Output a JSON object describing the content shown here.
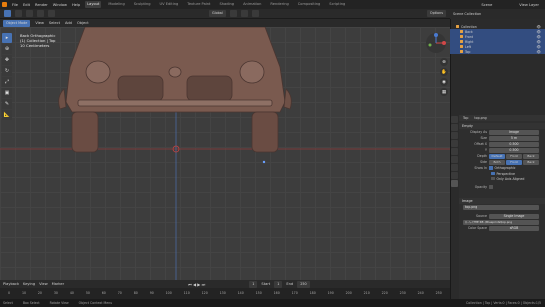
{
  "topbar": {
    "menus": [
      "File",
      "Edit",
      "Render",
      "Window",
      "Help"
    ],
    "workspaces": [
      "Layout",
      "Modeling",
      "Sculpting",
      "UV Editing",
      "Texture Paint",
      "Shading",
      "Animation",
      "Rendering",
      "Compositing",
      "Scripting"
    ],
    "active_workspace": "Layout",
    "scene": "Scene",
    "view_layer": "View Layer"
  },
  "toolbar": {
    "mode": "Object Mode",
    "menus": [
      "View",
      "Select",
      "Add",
      "Object"
    ],
    "orientation": "Global",
    "options": "Options"
  },
  "viewport": {
    "info_lines": [
      "Back Orthographic",
      "(1) Collection | Top",
      "10 Centimeters"
    ],
    "gizmo_axes": [
      "X",
      "Y",
      "Z"
    ]
  },
  "outliner": {
    "title": "Scene Collection",
    "rows": [
      {
        "label": "Collection",
        "selected": false
      },
      {
        "label": "Back",
        "selected": true
      },
      {
        "label": "Front",
        "selected": true
      },
      {
        "label": "Right",
        "selected": true
      },
      {
        "label": "Left",
        "selected": true
      },
      {
        "label": "Top",
        "selected": true
      }
    ]
  },
  "properties": {
    "object_name": "Top",
    "data_name": "top.png",
    "section_empty": "Empty",
    "display_as_label": "Display As",
    "display_as_value": "Image",
    "size_label": "Size",
    "size_value": "5 m",
    "offset_x_label": "Offset X",
    "offset_x_value": "0.500",
    "offset_y_label": "Y",
    "offset_y_value": "0.500",
    "depth_label": "Depth",
    "depth_options": [
      "Default",
      "Front",
      "Back"
    ],
    "side_label": "Side",
    "side_options": [
      "Both",
      "Front",
      "Back"
    ],
    "show_in_label": "Show In",
    "checks": [
      "Orthographic",
      "Perspective",
      "Only Axis Aligned"
    ],
    "opacity_label": "Opacity",
    "section_image": "Image",
    "image_name": "top.png",
    "source_label": "Source",
    "source_value": "Single Image",
    "filepath": "//...\\..\\THE RE..\\Blueprints\\top.png",
    "colorspace_label": "Color Space",
    "colorspace_value": "sRGB"
  },
  "timeline": {
    "menus": [
      "Playback",
      "Keying",
      "View",
      "Marker"
    ],
    "ticks": [
      "0",
      "10",
      "20",
      "30",
      "40",
      "50",
      "60",
      "70",
      "80",
      "90",
      "100",
      "110",
      "120",
      "130",
      "140",
      "150",
      "160",
      "170",
      "180",
      "190",
      "200",
      "210",
      "220",
      "230",
      "240",
      "250"
    ],
    "start_label": "Start",
    "start_value": "1",
    "end_label": "End",
    "end_value": "250",
    "current_frame": "1"
  },
  "status": {
    "items": [
      "Select",
      "Box Select",
      "Rotate View",
      "Object Context Menu"
    ],
    "right": "Collection | Top | Verts:0 | Faces:0 | Objects:1/5"
  },
  "colors": {
    "accent": "#4772b3",
    "orange": "#e87d0d"
  }
}
